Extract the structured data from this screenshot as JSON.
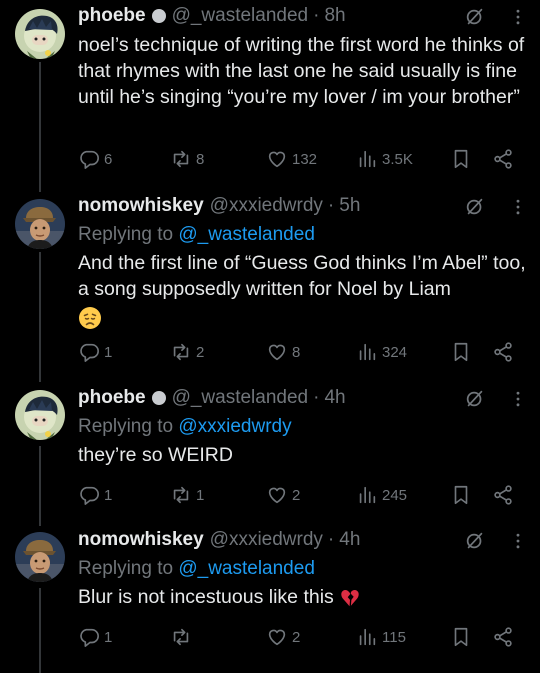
{
  "posts": [
    {
      "name": "phoebe",
      "handle": "@_wastelanded",
      "dot": "·",
      "time": "8h",
      "reply_prefix": "",
      "reply_to": "",
      "text": "noel’s technique of writing the first word he thinks of that rhymes with the last one he said usually is fine until he’s singing “you’re my lover / im your brother”",
      "replies": "6",
      "reposts": "8",
      "likes": "132",
      "views": "3.5K"
    },
    {
      "name": "nomowhiskey",
      "handle": "@xxxiedwrdy",
      "dot": "·",
      "time": "5h",
      "reply_prefix": "Replying to",
      "reply_to": "@_wastelanded",
      "text": "And the first line of “Guess God thinks I’m Abel” too, a song supposedly written for Noel by Liam",
      "emoji": "disappointed-face-emoji",
      "replies": "1",
      "reposts": "2",
      "likes": "8",
      "views": "324"
    },
    {
      "name": "phoebe",
      "handle": "@_wastelanded",
      "dot": "·",
      "time": "4h",
      "reply_prefix": "Replying to",
      "reply_to": "@xxxiedwrdy",
      "text": "they’re so WEIRD",
      "replies": "1",
      "reposts": "1",
      "likes": "2",
      "views": "245"
    },
    {
      "name": "nomowhiskey",
      "handle": "@xxxiedwrdy",
      "dot": "·",
      "time": "4h",
      "reply_prefix": "Replying to",
      "reply_to": "@_wastelanded",
      "text": "Blur is not incestuous like this",
      "emoji": "broken-heart-emoji",
      "replies": "1",
      "reposts": "",
      "likes": "2",
      "views": "115"
    }
  ],
  "colors": {
    "background": "#000000",
    "text": "#e7e9ea",
    "muted": "#71767b",
    "link": "#1d9bf0",
    "thread_line": "#333639"
  },
  "icons": [
    "grok-icon",
    "more-icon",
    "reply-icon",
    "repost-icon",
    "like-icon",
    "views-icon",
    "bookmark-icon",
    "share-icon"
  ]
}
